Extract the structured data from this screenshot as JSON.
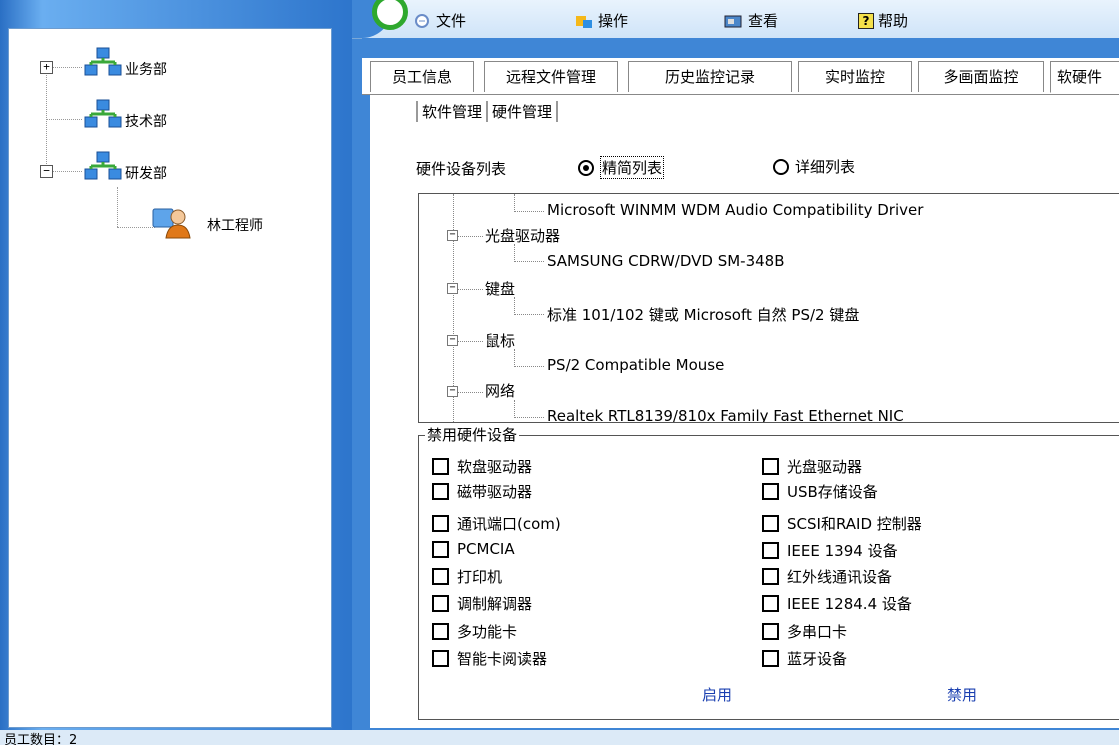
{
  "menu": [
    {
      "label": "文件",
      "icon": "document-icon"
    },
    {
      "label": "操作",
      "icon": "operation-icon"
    },
    {
      "label": "查看",
      "icon": "view-icon"
    },
    {
      "label": "帮助",
      "icon": "help-icon"
    }
  ],
  "help_icon_glyph": "?",
  "tree": {
    "departments": [
      {
        "label": "业务部",
        "toggle": "+"
      },
      {
        "label": "技术部",
        "toggle": ""
      },
      {
        "label": "研发部",
        "toggle": "−"
      }
    ],
    "employee": "林工程师"
  },
  "tabs": [
    "员工信息",
    "远程文件管理",
    "历史监控记录",
    "实时监控",
    "多画面监控",
    "软硬件"
  ],
  "subtabs": [
    "软件管理",
    "硬件管理"
  ],
  "hardware": {
    "list_label": "硬件设备列表",
    "radio_simple": "精简列表",
    "radio_detail": "详细列表",
    "rows": [
      {
        "type": "leaf",
        "text": "Microsoft WINMM WDM Audio Compatibility Driver"
      },
      {
        "type": "group",
        "text": "光盘驱动器"
      },
      {
        "type": "leaf",
        "text": "SAMSUNG CDRW/DVD SM-348B"
      },
      {
        "type": "group",
        "text": "键盘"
      },
      {
        "type": "leaf",
        "text": "标准 101/102 键或 Microsoft 自然 PS/2 键盘"
      },
      {
        "type": "group",
        "text": "鼠标"
      },
      {
        "type": "leaf",
        "text": "PS/2 Compatible Mouse"
      },
      {
        "type": "group",
        "text": "网络"
      },
      {
        "type": "leaf",
        "text": "Realtek RTL8139/810x Family Fast Ethernet NIC"
      }
    ],
    "toggle_glyph": "−"
  },
  "disable": {
    "legend": "禁用硬件设备",
    "left": [
      "软盘驱动器",
      "磁带驱动器",
      "通讯端口(com)",
      "PCMCIA",
      "打印机",
      "调制解调器",
      "多功能卡",
      "智能卡阅读器"
    ],
    "right": [
      "光盘驱动器",
      "USB存储设备",
      "SCSI和RAID 控制器",
      "IEEE 1394 设备",
      "红外线通讯设备",
      "IEEE 1284.4 设备",
      "多串口卡",
      "蓝牙设备"
    ],
    "enable_label": "启用",
    "disable_label": "禁用"
  },
  "status": "员工数目：2"
}
